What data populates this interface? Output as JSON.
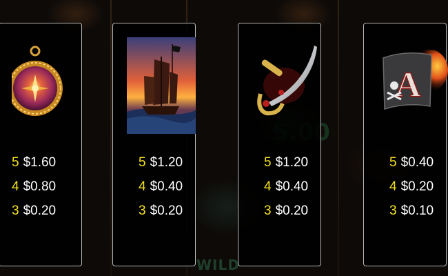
{
  "background": {
    "ghost_text": "WILD",
    "ghost_number": "5.00"
  },
  "colors": {
    "panel_border": "#b9b9b9",
    "count_color": "#f5e21a",
    "value_color": "#ffffff"
  },
  "panels": [
    {
      "symbol": "compass-icon",
      "pays": [
        {
          "count": "5",
          "value": "$1.60"
        },
        {
          "count": "4",
          "value": "$0.80"
        },
        {
          "count": "3",
          "value": "$0.20"
        }
      ]
    },
    {
      "symbol": "junk-ship-icon",
      "pays": [
        {
          "count": "5",
          "value": "$1.20"
        },
        {
          "count": "4",
          "value": "$0.40"
        },
        {
          "count": "3",
          "value": "$0.20"
        }
      ]
    },
    {
      "symbol": "cutlass-icon",
      "pays": [
        {
          "count": "5",
          "value": "$1.20"
        },
        {
          "count": "4",
          "value": "$0.40"
        },
        {
          "count": "3",
          "value": "$0.20"
        }
      ]
    },
    {
      "symbol": "pirate-flag-a-icon",
      "letter": "A",
      "pays": [
        {
          "count": "5",
          "value": "$0.40"
        },
        {
          "count": "4",
          "value": "$0.20"
        },
        {
          "count": "3",
          "value": "$0.10"
        }
      ]
    }
  ]
}
